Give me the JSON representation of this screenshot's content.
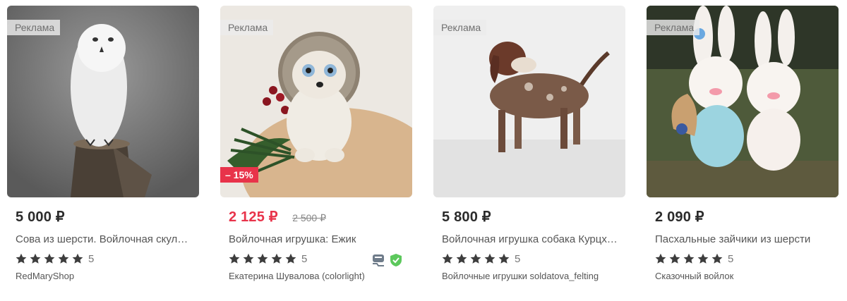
{
  "products": [
    {
      "ad_label": "Реклама",
      "price": "5 000 ₽",
      "title": "Сова из шерсти. Войлочная скульптура",
      "rating_count": "5",
      "shop": "RedMaryShop",
      "rating": 5
    },
    {
      "ad_label": "Реклама",
      "discount": "– 15%",
      "price": "2 125 ₽",
      "old_price": "2 500 ₽",
      "title": "Войлочная игрушка: Ежик",
      "rating_count": "5",
      "shop": "Екатерина Шувалова (colorlight)",
      "rating": 5,
      "badges": [
        "delivery-icon",
        "verified-shield-icon"
      ]
    },
    {
      "ad_label": "Реклама",
      "price": "5 800 ₽",
      "title": "Войлочная игрушка собака Курцхаар",
      "rating_count": "5",
      "shop": "Войлочные игрушки soldatova_felting",
      "rating": 5
    },
    {
      "ad_label": "Реклама",
      "price": "2 090 ₽",
      "title": "Пасхальные зайчики из шерсти",
      "rating_count": "5",
      "shop": "Сказочный войлок",
      "rating": 5
    }
  ],
  "colors": {
    "discount": "#e8334a",
    "star": "#3d3d3d",
    "shield": "#5cc85c"
  }
}
